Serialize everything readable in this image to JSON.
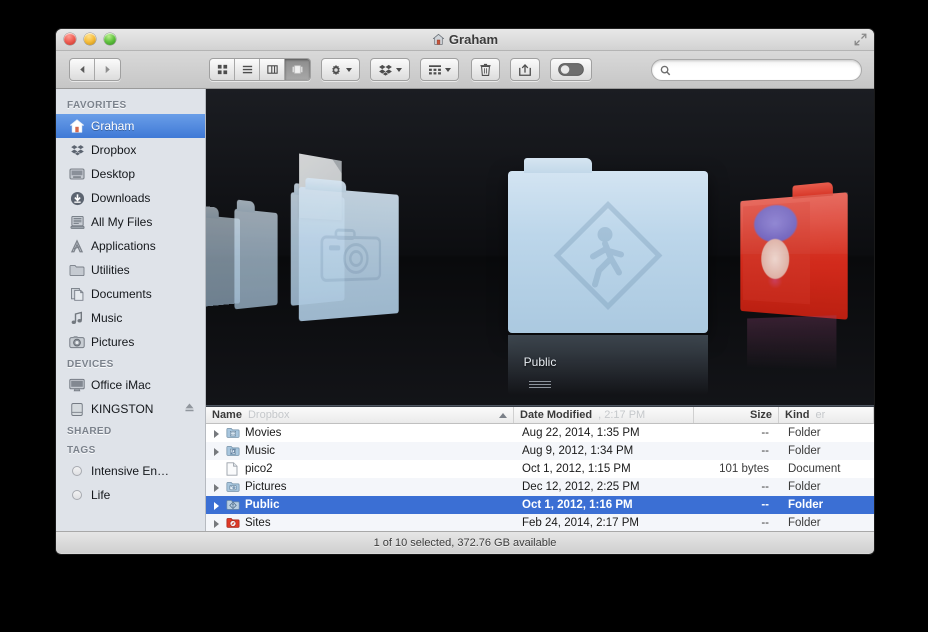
{
  "window": {
    "title": "Graham",
    "title_icon": "home-icon",
    "traffic_lights": [
      "close",
      "minimize",
      "zoom"
    ],
    "fullscreen_icon": "fullscreen-arrows-icon"
  },
  "toolbar": {
    "nav": {
      "back_icon": "chevron-left-icon",
      "forward_icon": "chevron-right-icon"
    },
    "views": [
      {
        "name": "icon-view",
        "icon": "grid-icon",
        "active": false
      },
      {
        "name": "list-view",
        "icon": "list-lines-icon",
        "active": false
      },
      {
        "name": "column-view",
        "icon": "columns-icon",
        "active": false
      },
      {
        "name": "coverflow-view",
        "icon": "coverflow-icon",
        "active": true
      }
    ],
    "actions": [
      {
        "name": "action-gear",
        "icon": "gear-icon",
        "has_menu": true
      },
      {
        "name": "dropbox",
        "icon": "dropbox-icon",
        "has_menu": true
      },
      {
        "name": "arrange",
        "icon": "arrange-grid-icon",
        "has_menu": true
      },
      {
        "name": "delete",
        "icon": "trash-icon",
        "has_menu": false
      },
      {
        "name": "share",
        "icon": "share-box-arrow-icon",
        "has_menu": false
      },
      {
        "name": "toggle",
        "icon": "toggle-switch-icon",
        "has_menu": false
      }
    ]
  },
  "search": {
    "value": "",
    "placeholder": "",
    "icon": "search-icon"
  },
  "sidebar": {
    "sections": [
      {
        "header": "FAVORITES",
        "items": [
          {
            "label": "Graham",
            "icon": "home-icon",
            "selected": true
          },
          {
            "label": "Dropbox",
            "icon": "dropbox-icon",
            "selected": false
          },
          {
            "label": "Desktop",
            "icon": "desktop-icon",
            "selected": false
          },
          {
            "label": "Downloads",
            "icon": "download-icon",
            "selected": false
          },
          {
            "label": "All My Files",
            "icon": "all-files-icon",
            "selected": false
          },
          {
            "label": "Applications",
            "icon": "applications-icon",
            "selected": false
          },
          {
            "label": "Utilities",
            "icon": "folder-icon",
            "selected": false
          },
          {
            "label": "Documents",
            "icon": "documents-icon",
            "selected": false
          },
          {
            "label": "Music",
            "icon": "music-note-icon",
            "selected": false
          },
          {
            "label": "Pictures",
            "icon": "camera-icon",
            "selected": false
          }
        ]
      },
      {
        "header": "DEVICES",
        "items": [
          {
            "label": "Office iMac",
            "icon": "imac-icon",
            "selected": false,
            "eject": false
          },
          {
            "label": "KINGSTON",
            "icon": "drive-icon",
            "selected": false,
            "eject": true
          }
        ]
      },
      {
        "header": "SHARED",
        "items": []
      },
      {
        "header": "TAGS",
        "items": [
          {
            "label": "Intensive En…",
            "icon": "tag-dot-icon",
            "selected": false
          },
          {
            "label": "Life",
            "icon": "tag-dot-icon",
            "selected": false
          }
        ]
      }
    ]
  },
  "coverflow": {
    "caption": "Public",
    "resize_handle": "coverflow-resize-handle",
    "items": [
      {
        "name": "folder-far-left-2",
        "kind": "folder",
        "badge": "none"
      },
      {
        "name": "folder-far-left-1",
        "kind": "folder",
        "badge": "none"
      },
      {
        "name": "document-preview",
        "kind": "document",
        "badge": "page"
      },
      {
        "name": "folder-pictures",
        "kind": "folder",
        "badge": "camera"
      },
      {
        "name": "folder-public",
        "kind": "folder",
        "badge": "walking-person",
        "selected": true
      },
      {
        "name": "folder-sites",
        "kind": "folder",
        "badge": "marilyn-artwork",
        "color": "#dd2c1c"
      }
    ]
  },
  "file_list": {
    "columns": [
      {
        "label": "Name",
        "sorted": true,
        "sort_direction": "ascending",
        "ghost": "Dropbox"
      },
      {
        "label": "Date Modified",
        "sorted": false,
        "ghost": ", 2:17 PM"
      },
      {
        "label": "Size",
        "sorted": false,
        "ghost": ""
      },
      {
        "label": "Kind",
        "sorted": false,
        "ghost": "er"
      }
    ],
    "rows": [
      {
        "name": "Movies",
        "icon": "folder-movies-icon",
        "date": "Aug 22, 2014, 1:35 PM",
        "size": "--",
        "kind": "Folder",
        "disclosure": true,
        "selected": false
      },
      {
        "name": "Music",
        "icon": "folder-music-icon",
        "date": "Aug 9, 2012, 1:34 PM",
        "size": "--",
        "kind": "Folder",
        "disclosure": true,
        "selected": false
      },
      {
        "name": "pico2",
        "icon": "document-icon",
        "date": "Oct 1, 2012, 1:15 PM",
        "size": "101 bytes",
        "kind": "Document",
        "disclosure": false,
        "selected": false
      },
      {
        "name": "Pictures",
        "icon": "folder-pictures-icon",
        "date": "Dec 12, 2012, 2:25 PM",
        "size": "--",
        "kind": "Folder",
        "disclosure": true,
        "selected": false
      },
      {
        "name": "Public",
        "icon": "folder-public-icon",
        "date": "Oct 1, 2012, 1:16 PM",
        "size": "--",
        "kind": "Folder",
        "disclosure": true,
        "selected": true
      },
      {
        "name": "Sites",
        "icon": "folder-sites-icon",
        "date": "Feb 24, 2014, 2:17 PM",
        "size": "--",
        "kind": "Folder",
        "disclosure": true,
        "selected": false
      }
    ]
  },
  "status_bar": {
    "text": "1 of 10 selected, 372.76 GB available"
  },
  "colors": {
    "selection_blue": "#3b6fd4",
    "sidebar_selection": "#3f79d6",
    "sidebar_bg": "#dfe3e9",
    "sites_red": "#dd2c1c",
    "desktop_bg": "#000000"
  }
}
